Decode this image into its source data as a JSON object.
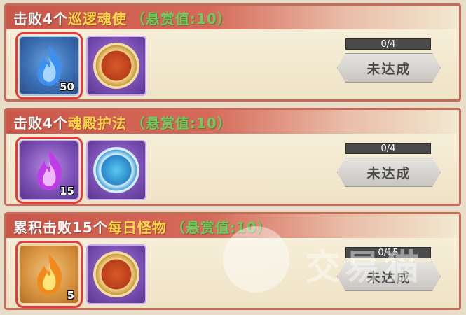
{
  "quests": [
    {
      "title_main": "击败4个",
      "title_target": "巡逻魂使",
      "title_reward": "（悬赏值:10）",
      "items": [
        {
          "icon": "blue-flame-icon",
          "quantity": "50",
          "selected": true
        },
        {
          "icon": "gold-emblem-icon",
          "quantity": "",
          "selected": false
        }
      ],
      "progress_text": "0/4",
      "progress_value": 0,
      "button_label": "未达成"
    },
    {
      "title_main": "击败4个",
      "title_target": "魂殿护法",
      "title_reward": "（悬赏值:10）",
      "items": [
        {
          "icon": "purple-flame-icon",
          "quantity": "15",
          "selected": true
        },
        {
          "icon": "blue-emblem-icon",
          "quantity": "",
          "selected": false
        }
      ],
      "progress_text": "0/4",
      "progress_value": 0,
      "button_label": "未达成"
    },
    {
      "title_main": "累积击败15个",
      "title_target": "每日怪物",
      "title_reward": "（悬赏值:10）",
      "items": [
        {
          "icon": "gold-flame-icon",
          "quantity": "5",
          "selected": true
        },
        {
          "icon": "gold-emblem-icon",
          "quantity": "",
          "selected": false
        }
      ],
      "progress_text": "0/15",
      "progress_value": 0,
      "button_label": "未达成"
    }
  ],
  "watermark": {
    "text": "交易猫",
    "icon": "cat-logo-icon"
  },
  "colors": {
    "header_red": "#c9574a",
    "title_yellow": "#ffd84a",
    "reward_green": "#6dcc5b",
    "selection_red": "#e63b3b"
  }
}
